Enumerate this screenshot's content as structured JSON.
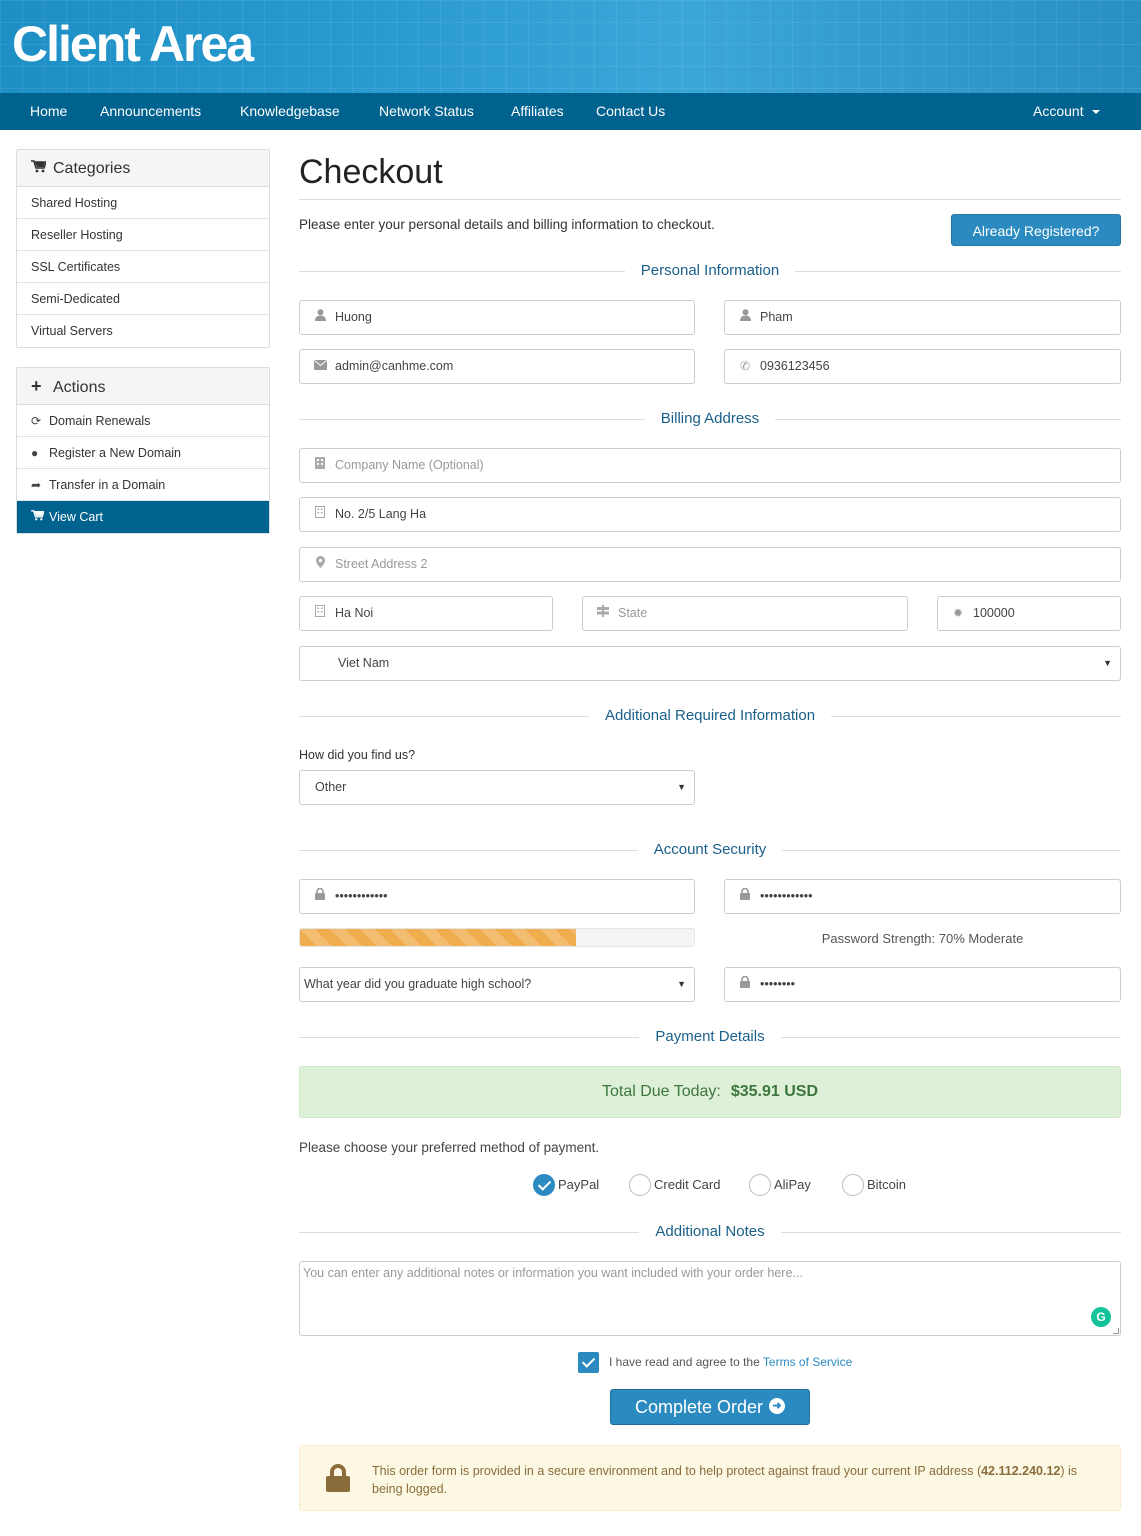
{
  "header": {
    "logo": "Client Area"
  },
  "nav": {
    "items": [
      "Home",
      "Announcements",
      "Knowledgebase",
      "Network Status",
      "Affiliates",
      "Contact Us"
    ],
    "account": "Account"
  },
  "sidebar": {
    "categories": {
      "title": "Categories",
      "items": [
        "Shared Hosting",
        "Reseller Hosting",
        "SSL Certificates",
        "Semi-Dedicated",
        "Virtual Servers"
      ]
    },
    "actions": {
      "title": "Actions",
      "items": [
        "Domain Renewals",
        "Register a New Domain",
        "Transfer in a Domain",
        "View Cart"
      ]
    }
  },
  "checkout": {
    "title": "Checkout",
    "intro": "Please enter your personal details and billing information to checkout.",
    "already_registered": "Already Registered?"
  },
  "sections": {
    "personal": "Personal Information",
    "billing": "Billing Address",
    "additional": "Additional Required Information",
    "security": "Account Security",
    "payment": "Payment Details",
    "notes": "Additional Notes"
  },
  "personal": {
    "first_name": "Huong",
    "last_name": "Pham",
    "email": "admin@canhme.com",
    "phone": "0936123456"
  },
  "billing": {
    "company_placeholder": "Company Name (Optional)",
    "address1": "No. 2/5 Lang Ha",
    "address2_placeholder": "Street Address 2",
    "city": "Ha Noi",
    "state_placeholder": "State",
    "postcode": "100000",
    "country": "Viet Nam"
  },
  "additional": {
    "question": "How did you find us?",
    "answer": "Other"
  },
  "security": {
    "password": "••••••••••••",
    "password_confirm": "••••••••••••",
    "strength_percent": 70,
    "strength_text": "Password Strength: 70% Moderate",
    "question": "What year did you graduate high school?",
    "answer": "••••••••"
  },
  "payment": {
    "total_label": "Total Due Today:",
    "total_amount": "$35.91 USD",
    "choose_text": "Please choose your preferred method of payment.",
    "methods": [
      "PayPal",
      "Credit Card",
      "AliPay",
      "Bitcoin"
    ],
    "selected": "PayPal"
  },
  "notes": {
    "placeholder": "You can enter any additional notes or information you want included with your order here..."
  },
  "tos": {
    "text": "I have read and agree to the ",
    "link": "Terms of Service"
  },
  "complete_button": "Complete Order",
  "secure_notice": {
    "text_before": "This order form is provided in a secure environment and to help protect against fraud your current IP address (",
    "ip": "42.112.240.12",
    "text_after": ") is being logged."
  },
  "colors": {
    "nav_bg": "#00628f",
    "accent": "#2b8bc0",
    "section_title": "#1a5f8a",
    "strength_bar": "#f0ad4e",
    "total_bg": "#dff0d8"
  }
}
